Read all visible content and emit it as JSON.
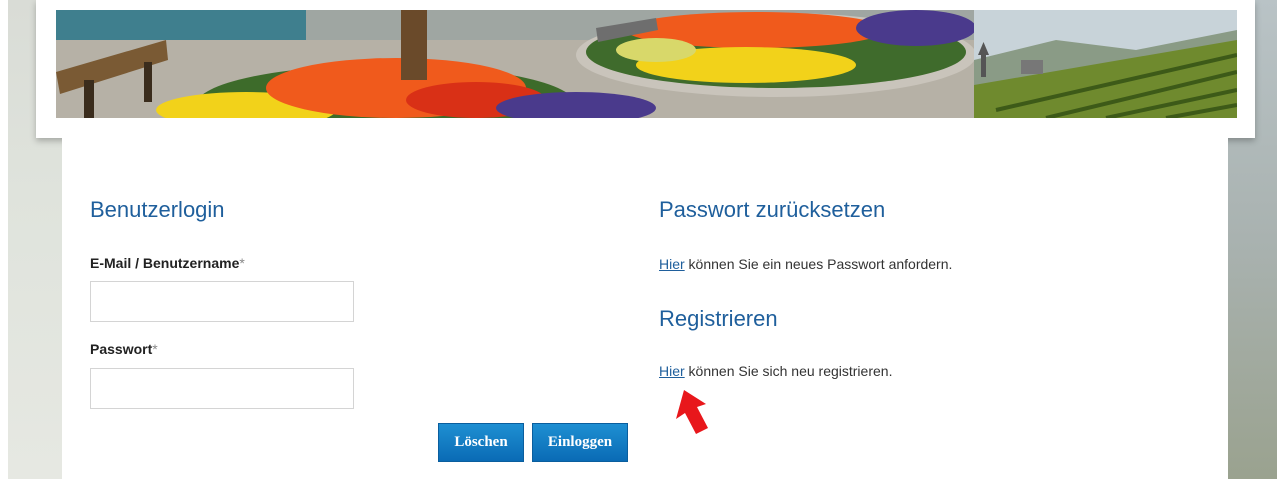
{
  "login": {
    "heading": "Benutzerlogin",
    "username_label": "E-Mail / Benutzername",
    "password_label": "Passwort",
    "required_mark": "*",
    "username_value": "",
    "password_value": "",
    "clear_button": "Löschen",
    "login_button": "Einloggen"
  },
  "reset": {
    "heading": "Passwort zurücksetzen",
    "link": "Hier",
    "text": " können Sie ein neues Passwort anfordern."
  },
  "register": {
    "heading": "Registrieren",
    "link": "Hier",
    "text": " können Sie sich neu registrieren."
  },
  "colors": {
    "heading": "#1f5f9c",
    "button": "#0a6bb5",
    "annotation_arrow": "#e8171b"
  }
}
